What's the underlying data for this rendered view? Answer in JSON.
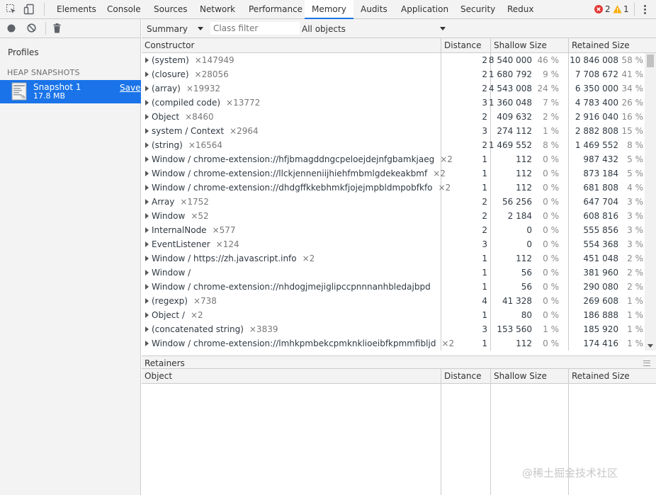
{
  "topbar": {
    "tabs": [
      "Elements",
      "Console",
      "Sources",
      "Network",
      "Performance",
      "Memory",
      "Audits",
      "Application",
      "Security",
      "Redux"
    ],
    "active_tab": "Memory",
    "error_count": "2",
    "warning_count": "1"
  },
  "sidebar": {
    "profiles_label": "Profiles",
    "heap_section": "HEAP SNAPSHOTS",
    "snapshot_title": "Snapshot 1",
    "snapshot_size": "17.8 MB",
    "save_label": "Save"
  },
  "toolbar": {
    "view": "Summary",
    "class_filter_placeholder": "Class filter",
    "objects_filter": "All objects"
  },
  "grid": {
    "headers": {
      "constructor": "Constructor",
      "distance": "Distance",
      "shallow": "Shallow Size",
      "retained": "Retained Size"
    },
    "rows": [
      {
        "name": "(system)",
        "count": "×147949",
        "distance": "2",
        "shallow": "8 540 000",
        "shallow_pct": "46 %",
        "retained": "10 846 008",
        "retained_pct": "58 %"
      },
      {
        "name": "(closure)",
        "count": "×28056",
        "distance": "2",
        "shallow": "1 680 792",
        "shallow_pct": "9 %",
        "retained": "7 708 672",
        "retained_pct": "41 %"
      },
      {
        "name": "(array)",
        "count": "×19932",
        "distance": "2",
        "shallow": "4 543 008",
        "shallow_pct": "24 %",
        "retained": "6 350 000",
        "retained_pct": "34 %"
      },
      {
        "name": "(compiled code)",
        "count": "×13772",
        "distance": "3",
        "shallow": "1 360 048",
        "shallow_pct": "7 %",
        "retained": "4 783 400",
        "retained_pct": "26 %"
      },
      {
        "name": "Object",
        "count": "×8460",
        "distance": "2",
        "shallow": "409 632",
        "shallow_pct": "2 %",
        "retained": "2 916 040",
        "retained_pct": "16 %"
      },
      {
        "name": "system / Context",
        "count": "×2964",
        "distance": "3",
        "shallow": "274 112",
        "shallow_pct": "1 %",
        "retained": "2 882 808",
        "retained_pct": "15 %"
      },
      {
        "name": "(string)",
        "count": "×16564",
        "distance": "2",
        "shallow": "1 469 552",
        "shallow_pct": "8 %",
        "retained": "1 469 552",
        "retained_pct": "8 %"
      },
      {
        "name": "Window / chrome-extension://hfjbmagddngcpeloejdejnfgbamkjaeg",
        "count": "×2",
        "distance": "1",
        "shallow": "112",
        "shallow_pct": "0 %",
        "retained": "987 432",
        "retained_pct": "5 %"
      },
      {
        "name": "Window / chrome-extension://llckjenneniijhiehfmbmlgdekeakbmf",
        "count": "×2",
        "distance": "1",
        "shallow": "112",
        "shallow_pct": "0 %",
        "retained": "873 184",
        "retained_pct": "5 %"
      },
      {
        "name": "Window / chrome-extension://dhdgffkkebhmkfjojejmpbldmpobfkfo",
        "count": "×2",
        "distance": "1",
        "shallow": "112",
        "shallow_pct": "0 %",
        "retained": "681 808",
        "retained_pct": "4 %"
      },
      {
        "name": "Array",
        "count": "×1752",
        "distance": "2",
        "shallow": "56 256",
        "shallow_pct": "0 %",
        "retained": "647 704",
        "retained_pct": "3 %"
      },
      {
        "name": "Window",
        "count": "×52",
        "distance": "2",
        "shallow": "2 184",
        "shallow_pct": "0 %",
        "retained": "608 816",
        "retained_pct": "3 %"
      },
      {
        "name": "InternalNode",
        "count": "×577",
        "distance": "2",
        "shallow": "0",
        "shallow_pct": "0 %",
        "retained": "555 856",
        "retained_pct": "3 %"
      },
      {
        "name": "EventListener",
        "count": "×124",
        "distance": "3",
        "shallow": "0",
        "shallow_pct": "0 %",
        "retained": "554 368",
        "retained_pct": "3 %"
      },
      {
        "name": "Window / https://zh.javascript.info",
        "count": "×2",
        "distance": "1",
        "shallow": "112",
        "shallow_pct": "0 %",
        "retained": "451 048",
        "retained_pct": "2 %"
      },
      {
        "name": "Window /",
        "count": "",
        "distance": "1",
        "shallow": "56",
        "shallow_pct": "0 %",
        "retained": "381 960",
        "retained_pct": "2 %"
      },
      {
        "name": "Window / chrome-extension://nhdogjmejiglipccpnnnanhbledajbpd",
        "count": "",
        "distance": "1",
        "shallow": "56",
        "shallow_pct": "0 %",
        "retained": "290 080",
        "retained_pct": "2 %"
      },
      {
        "name": "(regexp)",
        "count": "×738",
        "distance": "4",
        "shallow": "41 328",
        "shallow_pct": "0 %",
        "retained": "269 608",
        "retained_pct": "1 %"
      },
      {
        "name": "Object /",
        "count": "×2",
        "distance": "1",
        "shallow": "80",
        "shallow_pct": "0 %",
        "retained": "186 888",
        "retained_pct": "1 %"
      },
      {
        "name": "(concatenated string)",
        "count": "×3839",
        "distance": "3",
        "shallow": "153 560",
        "shallow_pct": "1 %",
        "retained": "185 920",
        "retained_pct": "1 %"
      },
      {
        "name": "Window / chrome-extension://lmhkpmbekcpmknklioeibfkpmmfibljd",
        "count": "×2",
        "distance": "1",
        "shallow": "112",
        "shallow_pct": "0 %",
        "retained": "174 416",
        "retained_pct": "1 %"
      }
    ]
  },
  "retainers": {
    "title": "Retainers",
    "headers": {
      "object": "Object",
      "distance": "Distance",
      "shallow": "Shallow Size",
      "retained": "Retained Size"
    }
  },
  "watermark": "@稀土掘金技术社区",
  "colors": {
    "accent": "#1a73e8",
    "error": "#e53935",
    "warning": "#f9ab00"
  },
  "icons": [
    "inspect-element-icon",
    "device-toolbar-icon",
    "record-icon",
    "clear-icon",
    "delete-icon",
    "error-icon",
    "warning-icon",
    "more-options-icon",
    "heap-snapshot-icon",
    "expand-triangle-icon"
  ]
}
